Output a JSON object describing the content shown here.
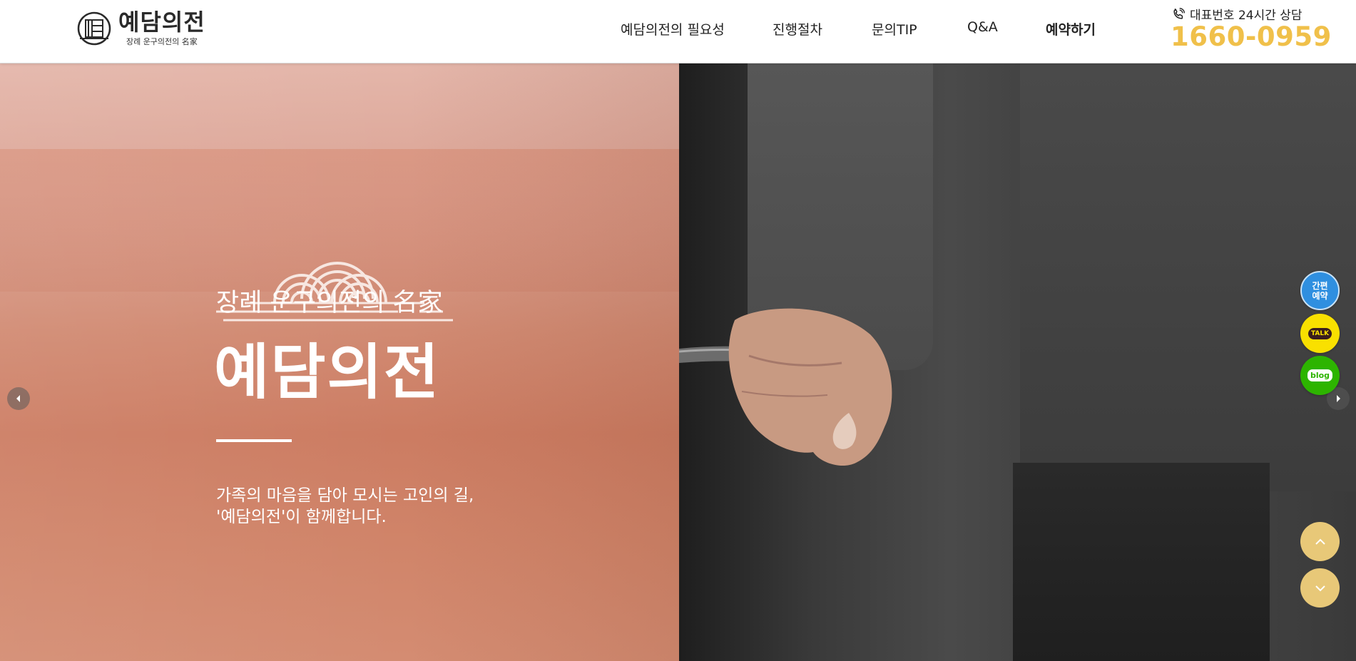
{
  "header": {
    "logo_title": "예담의전",
    "logo_sub": "장례 운구의전의 名家",
    "nav": [
      {
        "label": "예담의전의 필요성",
        "bold": false
      },
      {
        "label": "진행절차",
        "bold": false
      },
      {
        "label": "문의TIP",
        "bold": false
      },
      {
        "label": "Q&A",
        "bold": false
      },
      {
        "label": "예약하기",
        "bold": true
      }
    ],
    "phone_label": "대표번호 24시간 상담",
    "phone_number": "1660-0959"
  },
  "hero": {
    "tagline": "장례 운구의전의 名家",
    "title": "예담의전",
    "desc_line1": "가족의 마음을 담아 모시는 고인의 길,",
    "desc_line2": "'예담의전'이 함께합니다."
  },
  "floating": {
    "reserve_label": "간편예약",
    "talk_label": "TALK",
    "blog_label": "blog"
  },
  "colors": {
    "accent": "#f0c04a",
    "scroll_button": "#e8c878",
    "reserve_blue": "#2f8fe0",
    "kakao_yellow": "#f9e000",
    "blog_green": "#2db400"
  }
}
